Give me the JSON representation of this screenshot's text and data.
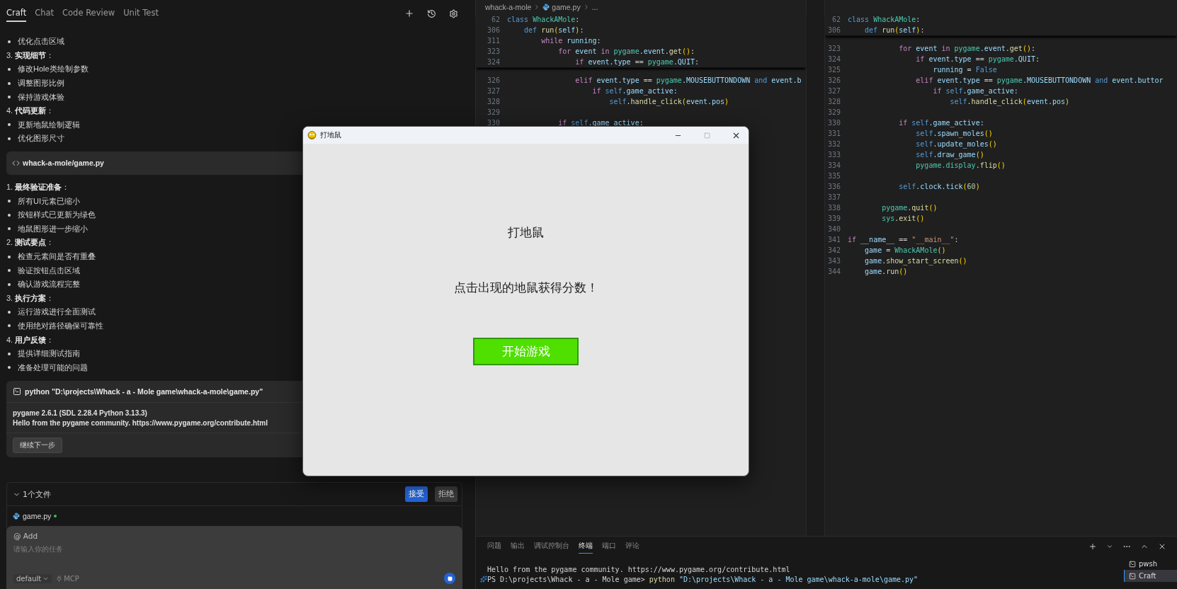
{
  "left_panel": {
    "tabs": [
      {
        "label": "Craft",
        "selected": true
      },
      {
        "label": "Chat",
        "selected": false
      },
      {
        "label": "Code Review",
        "selected": false
      },
      {
        "label": "Unit Test",
        "selected": false
      }
    ],
    "conversation": [
      {
        "kind": "bullet",
        "text": "优化点击区域"
      },
      {
        "kind": "heading",
        "text": "3. **实现细节**："
      },
      {
        "kind": "bullet",
        "text": "修改Hole类绘制参数"
      },
      {
        "kind": "bullet",
        "text": "调整图形比例"
      },
      {
        "kind": "bullet",
        "text": "保持游戏体验"
      },
      {
        "kind": "heading",
        "text": "4. **代码更新**："
      },
      {
        "kind": "bullet",
        "text": "更新地鼠绘制逻辑"
      },
      {
        "kind": "bullet",
        "text": "优化图形尺寸"
      },
      {
        "kind": "file",
        "text": "whack-a-mole/game.py"
      },
      {
        "kind": "heading",
        "text": "1. **最终验证准备**："
      },
      {
        "kind": "bullet",
        "text": "所有UI元素已缩小"
      },
      {
        "kind": "bullet",
        "text": "按钮样式已更新为绿色"
      },
      {
        "kind": "bullet",
        "text": "地鼠图形进一步缩小"
      },
      {
        "kind": "heading",
        "text": "2. **测试要点**："
      },
      {
        "kind": "bullet",
        "text": "检查元素间是否有重叠"
      },
      {
        "kind": "bullet",
        "text": "验证按钮点击区域"
      },
      {
        "kind": "bullet",
        "text": "确认游戏流程完整"
      },
      {
        "kind": "heading",
        "text": "3. **执行方案**："
      },
      {
        "kind": "bullet",
        "text": "运行游戏进行全面测试"
      },
      {
        "kind": "bullet",
        "text": "使用绝对路径确保可靠性"
      },
      {
        "kind": "heading",
        "text": "4. **用户反馈**："
      },
      {
        "kind": "bullet",
        "text": "提供详细测试指南"
      },
      {
        "kind": "bullet",
        "text": "准备处理可能的问题"
      },
      {
        "kind": "command",
        "command": "python \"D:\\projects\\Whack - a - Mole game\\whack-a-mole\\game.py\"",
        "output": [
          "pygame 2.6.1 (SDL 2.28.4 Python 3.13.3)",
          "Hello from the pygame community. https://www.pygame.org/contribute.html"
        ],
        "button": "继续下一步"
      }
    ],
    "changes": {
      "expanded": true,
      "title": "1个文件",
      "accept": "接受",
      "reject": "拒绝",
      "files": [
        {
          "name": "game.py",
          "modified": true
        }
      ]
    },
    "composer": {
      "mention": "@ Add",
      "placeholder": "请输入你的任务",
      "mode": "default",
      "tool": "MCP"
    }
  },
  "editor": {
    "breadcrumb": [
      "whack-a-mole",
      "game.py",
      "..."
    ],
    "groups": [
      {
        "sticky": [
          {
            "n": "62",
            "tokens": [
              {
                "text": "class ",
                "kind": "kw"
              },
              {
                "text": "WhackAMole",
                "kind": "cls"
              },
              {
                "text": ":",
                "kind": "p"
              }
            ]
          },
          {
            "n": "306",
            "tokens": [
              {
                "text": "    def ",
                "kind": "kw"
              },
              {
                "text": "run",
                "kind": "fn"
              },
              {
                "text": "(",
                "kind": "br"
              },
              {
                "text": "self",
                "kind": "var"
              },
              {
                "text": ")",
                "kind": "br"
              },
              {
                "text": ":",
                "kind": "p"
              }
            ]
          },
          {
            "n": "311",
            "tokens": [
              {
                "text": "        while",
                "kind": "ctl"
              },
              {
                "text": " running",
                "kind": "var"
              },
              {
                "text": ":",
                "kind": "p"
              }
            ]
          },
          {
            "n": "323",
            "tokens": [
              {
                "text": "            for",
                "kind": "ctl"
              },
              {
                "text": " event ",
                "kind": "var"
              },
              {
                "text": "in",
                "kind": "ctl"
              },
              {
                "text": " pygame",
                "kind": "cls"
              },
              {
                "text": ".event.",
                "kind": "var"
              },
              {
                "text": "get",
                "kind": "fn"
              },
              {
                "text": "()",
                "kind": "br"
              },
              {
                "text": ":",
                "kind": "p"
              }
            ]
          },
          {
            "n": "324",
            "tokens": [
              {
                "text": "                if",
                "kind": "ctl"
              },
              {
                "text": " event.type ",
                "kind": "var"
              },
              {
                "text": "==",
                "kind": "p"
              },
              {
                "text": " pygame",
                "kind": "cls"
              },
              {
                "text": ".QUIT",
                "kind": "var"
              },
              {
                "text": ":",
                "kind": "p"
              }
            ]
          }
        ],
        "lines": [
          {
            "n": "326",
            "tokens": [
              {
                "text": "                elif",
                "kind": "ctl"
              },
              {
                "text": " event.type ",
                "kind": "var"
              },
              {
                "text": "==",
                "kind": "p"
              },
              {
                "text": " pygame",
                "kind": "cls"
              },
              {
                "text": ".MOUSEBUTTONDOWN ",
                "kind": "var"
              },
              {
                "text": "and",
                "kind": "kw"
              },
              {
                "text": " event.b",
                "kind": "var"
              }
            ]
          },
          {
            "n": "327",
            "tokens": [
              {
                "text": "                    if",
                "kind": "ctl"
              },
              {
                "text": " self",
                "kind": "kw"
              },
              {
                "text": ".game_active:",
                "kind": "var"
              }
            ]
          },
          {
            "n": "328",
            "tokens": [
              {
                "text": "                        self",
                "kind": "kw"
              },
              {
                "text": ".handle_click",
                "kind": "fn"
              },
              {
                "text": "(",
                "kind": "br"
              },
              {
                "text": "event.pos",
                "kind": "var"
              },
              {
                "text": ")",
                "kind": "br"
              }
            ]
          },
          {
            "n": "329"
          },
          {
            "n": "330",
            "tokens": [
              {
                "text": "            if",
                "kind": "ctl"
              },
              {
                "text": " self",
                "kind": "kw"
              },
              {
                "text": ".game_active:",
                "kind": "var"
              }
            ]
          }
        ]
      },
      {
        "sticky": [
          {
            "n": "62",
            "tokens": [
              {
                "text": "class ",
                "kind": "kw"
              },
              {
                "text": "WhackAMole",
                "kind": "cls"
              },
              {
                "text": ":",
                "kind": "p"
              }
            ]
          },
          {
            "n": "306",
            "tokens": [
              {
                "text": "    def ",
                "kind": "kw"
              },
              {
                "text": "run",
                "kind": "fn"
              },
              {
                "text": "(",
                "kind": "br"
              },
              {
                "text": "self",
                "kind": "var"
              },
              {
                "text": ")",
                "kind": "br"
              },
              {
                "text": ":",
                "kind": "p"
              }
            ]
          }
        ],
        "lines": [
          {
            "n": "323",
            "tokens": [
              {
                "text": "            for",
                "kind": "ctl"
              },
              {
                "text": " event ",
                "kind": "var"
              },
              {
                "text": "in",
                "kind": "ctl"
              },
              {
                "text": " pygame",
                "kind": "cls"
              },
              {
                "text": ".event.",
                "kind": "var"
              },
              {
                "text": "get",
                "kind": "fn"
              },
              {
                "text": "()",
                "kind": "br"
              },
              {
                "text": ":",
                "kind": "p"
              }
            ]
          },
          {
            "n": "324",
            "tokens": [
              {
                "text": "                if",
                "kind": "ctl"
              },
              {
                "text": " event.type ",
                "kind": "var"
              },
              {
                "text": "==",
                "kind": "p"
              },
              {
                "text": " pygame",
                "kind": "cls"
              },
              {
                "text": ".QUIT",
                "kind": "var"
              },
              {
                "text": ":",
                "kind": "p"
              }
            ]
          },
          {
            "n": "325",
            "tokens": [
              {
                "text": "                    running ",
                "kind": "var"
              },
              {
                "text": "=",
                "kind": "p"
              },
              {
                "text": " False",
                "kind": "kw"
              }
            ]
          },
          {
            "n": "326",
            "tokens": [
              {
                "text": "                elif",
                "kind": "ctl"
              },
              {
                "text": " event.type ",
                "kind": "var"
              },
              {
                "text": "==",
                "kind": "p"
              },
              {
                "text": " pygame",
                "kind": "cls"
              },
              {
                "text": ".MOUSEBUTTONDOWN ",
                "kind": "var"
              },
              {
                "text": "and",
                "kind": "kw"
              },
              {
                "text": " event.buttor",
                "kind": "var"
              }
            ]
          },
          {
            "n": "327",
            "tokens": [
              {
                "text": "                    if",
                "kind": "ctl"
              },
              {
                "text": " self",
                "kind": "kw"
              },
              {
                "text": ".game_active:",
                "kind": "var"
              }
            ]
          },
          {
            "n": "328",
            "tokens": [
              {
                "text": "                        self",
                "kind": "kw"
              },
              {
                "text": ".handle_click",
                "kind": "fn"
              },
              {
                "text": "(",
                "kind": "br"
              },
              {
                "text": "event.pos",
                "kind": "var"
              },
              {
                "text": ")",
                "kind": "br"
              }
            ]
          },
          {
            "n": "329"
          },
          {
            "n": "330",
            "tokens": [
              {
                "text": "            if",
                "kind": "ctl"
              },
              {
                "text": " self",
                "kind": "kw"
              },
              {
                "text": ".game_active:",
                "kind": "var"
              }
            ]
          },
          {
            "n": "331",
            "tokens": [
              {
                "text": "                self",
                "kind": "kw"
              },
              {
                "text": ".spawn_moles",
                "kind": "var"
              },
              {
                "text": "()",
                "kind": "br"
              }
            ]
          },
          {
            "n": "332",
            "tokens": [
              {
                "text": "                self",
                "kind": "kw"
              },
              {
                "text": ".update_moles",
                "kind": "var"
              },
              {
                "text": "()",
                "kind": "br"
              }
            ]
          },
          {
            "n": "333",
            "tokens": [
              {
                "text": "                self",
                "kind": "kw"
              },
              {
                "text": ".draw_game",
                "kind": "var"
              },
              {
                "text": "()",
                "kind": "br"
              }
            ]
          },
          {
            "n": "334",
            "tokens": [
              {
                "text": "                pygame.display",
                "kind": "cls"
              },
              {
                "text": ".flip",
                "kind": "fn"
              },
              {
                "text": "()",
                "kind": "br"
              }
            ]
          },
          {
            "n": "335"
          },
          {
            "n": "336",
            "tokens": [
              {
                "text": "            self",
                "kind": "kw"
              },
              {
                "text": ".clock.tick",
                "kind": "var"
              },
              {
                "text": "(",
                "kind": "br"
              },
              {
                "text": "60",
                "kind": "num"
              },
              {
                "text": ")",
                "kind": "br"
              }
            ]
          },
          {
            "n": "337"
          },
          {
            "n": "338",
            "tokens": [
              {
                "text": "        pygame",
                "kind": "cls"
              },
              {
                "text": ".quit",
                "kind": "fn"
              },
              {
                "text": "()",
                "kind": "br"
              }
            ]
          },
          {
            "n": "339",
            "tokens": [
              {
                "text": "        sys",
                "kind": "cls"
              },
              {
                "text": ".exit",
                "kind": "fn"
              },
              {
                "text": "()",
                "kind": "br"
              }
            ]
          },
          {
            "n": "340"
          },
          {
            "n": "341",
            "tokens": [
              {
                "text": "if",
                "kind": "ctl"
              },
              {
                "text": " __name__ ",
                "kind": "var"
              },
              {
                "text": "==",
                "kind": "p"
              },
              {
                "text": " \"__main__\"",
                "kind": "str"
              },
              {
                "text": ":",
                "kind": "p"
              }
            ]
          },
          {
            "n": "342",
            "tokens": [
              {
                "text": "    game ",
                "kind": "var"
              },
              {
                "text": "=",
                "kind": "p"
              },
              {
                "text": " WhackAMole",
                "kind": "cls"
              },
              {
                "text": "()",
                "kind": "br"
              }
            ]
          },
          {
            "n": "343",
            "tokens": [
              {
                "text": "    game",
                "kind": "var"
              },
              {
                "text": ".show_start_screen",
                "kind": "fn"
              },
              {
                "text": "()",
                "kind": "br"
              }
            ]
          },
          {
            "n": "344",
            "tokens": [
              {
                "text": "    game",
                "kind": "var"
              },
              {
                "text": ".run",
                "kind": "fn"
              },
              {
                "text": "()",
                "kind": "br"
              }
            ]
          }
        ]
      }
    ]
  },
  "terminal": {
    "tabs": [
      {
        "label": "问题",
        "selected": false
      },
      {
        "label": "输出",
        "selected": false
      },
      {
        "label": "调试控制台",
        "selected": false
      },
      {
        "label": "终端",
        "selected": true
      },
      {
        "label": "端口",
        "selected": false
      },
      {
        "label": "评论",
        "selected": false
      }
    ],
    "lines": [
      {
        "tokens": [
          {
            "text": "Hello from the pygame community. https://www.pygame.org/contribute.html",
            "kind": "p"
          }
        ]
      },
      {
        "tokens": [
          {
            "text": "PS D:\\projects\\Whack - a - Mole game> ",
            "kind": "p"
          },
          {
            "text": "python",
            "kind": "fn"
          },
          {
            "text": " \"D:\\projects\\Whack - a - Mole game\\whack-a-mole\\game.py\"",
            "kind": "var"
          }
        ]
      }
    ],
    "sessions": [
      {
        "name": "pwsh",
        "selected": false
      },
      {
        "name": "Craft",
        "selected": true
      }
    ]
  },
  "game_window": {
    "title": "打地鼠",
    "heading": "打地鼠",
    "subtitle": "点击出现的地鼠获得分数！",
    "button": "开始游戏"
  }
}
